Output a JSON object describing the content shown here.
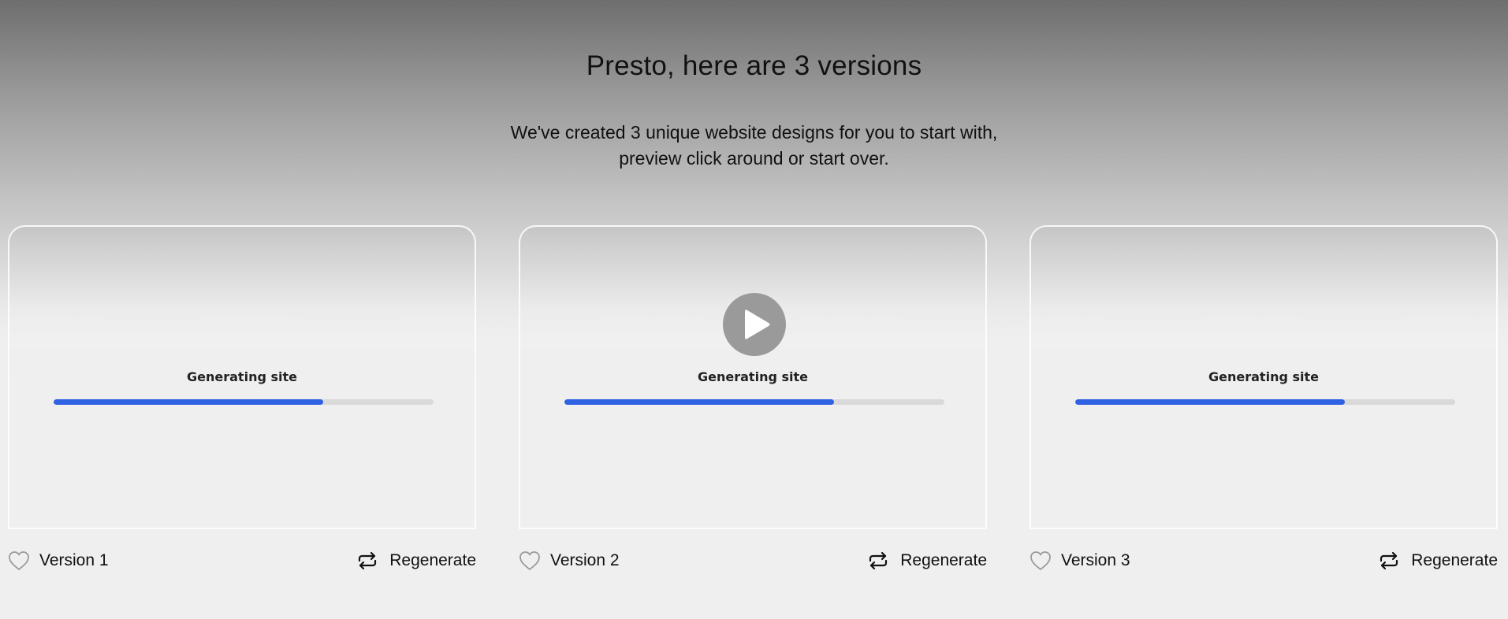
{
  "header": {
    "title": "Presto, here are 3 versions",
    "subtitle_line1": "We've created 3 unique website designs for you to start with,",
    "subtitle_line2": "preview click around or start over."
  },
  "colors": {
    "progress_fill": "#2f62e2",
    "progress_track": "#d9d9d9",
    "play_button": "#9a9a9a"
  },
  "cards": [
    {
      "status_text": "Generating site",
      "progress": 0.71,
      "version_label": "Version 1",
      "favorite_icon": "heart-outline-icon",
      "regenerate_icon": "repeat-icon",
      "regenerate_label": "Regenerate"
    },
    {
      "status_text": "Generating site",
      "progress": 0.71,
      "version_label": "Version 2",
      "favorite_icon": "heart-outline-icon",
      "regenerate_icon": "repeat-icon",
      "regenerate_label": "Regenerate",
      "play_icon": "play-icon"
    },
    {
      "status_text": "Generating site",
      "progress": 0.71,
      "version_label": "Version 3",
      "favorite_icon": "heart-outline-icon",
      "regenerate_icon": "repeat-icon",
      "regenerate_label": "Regenerate"
    }
  ]
}
